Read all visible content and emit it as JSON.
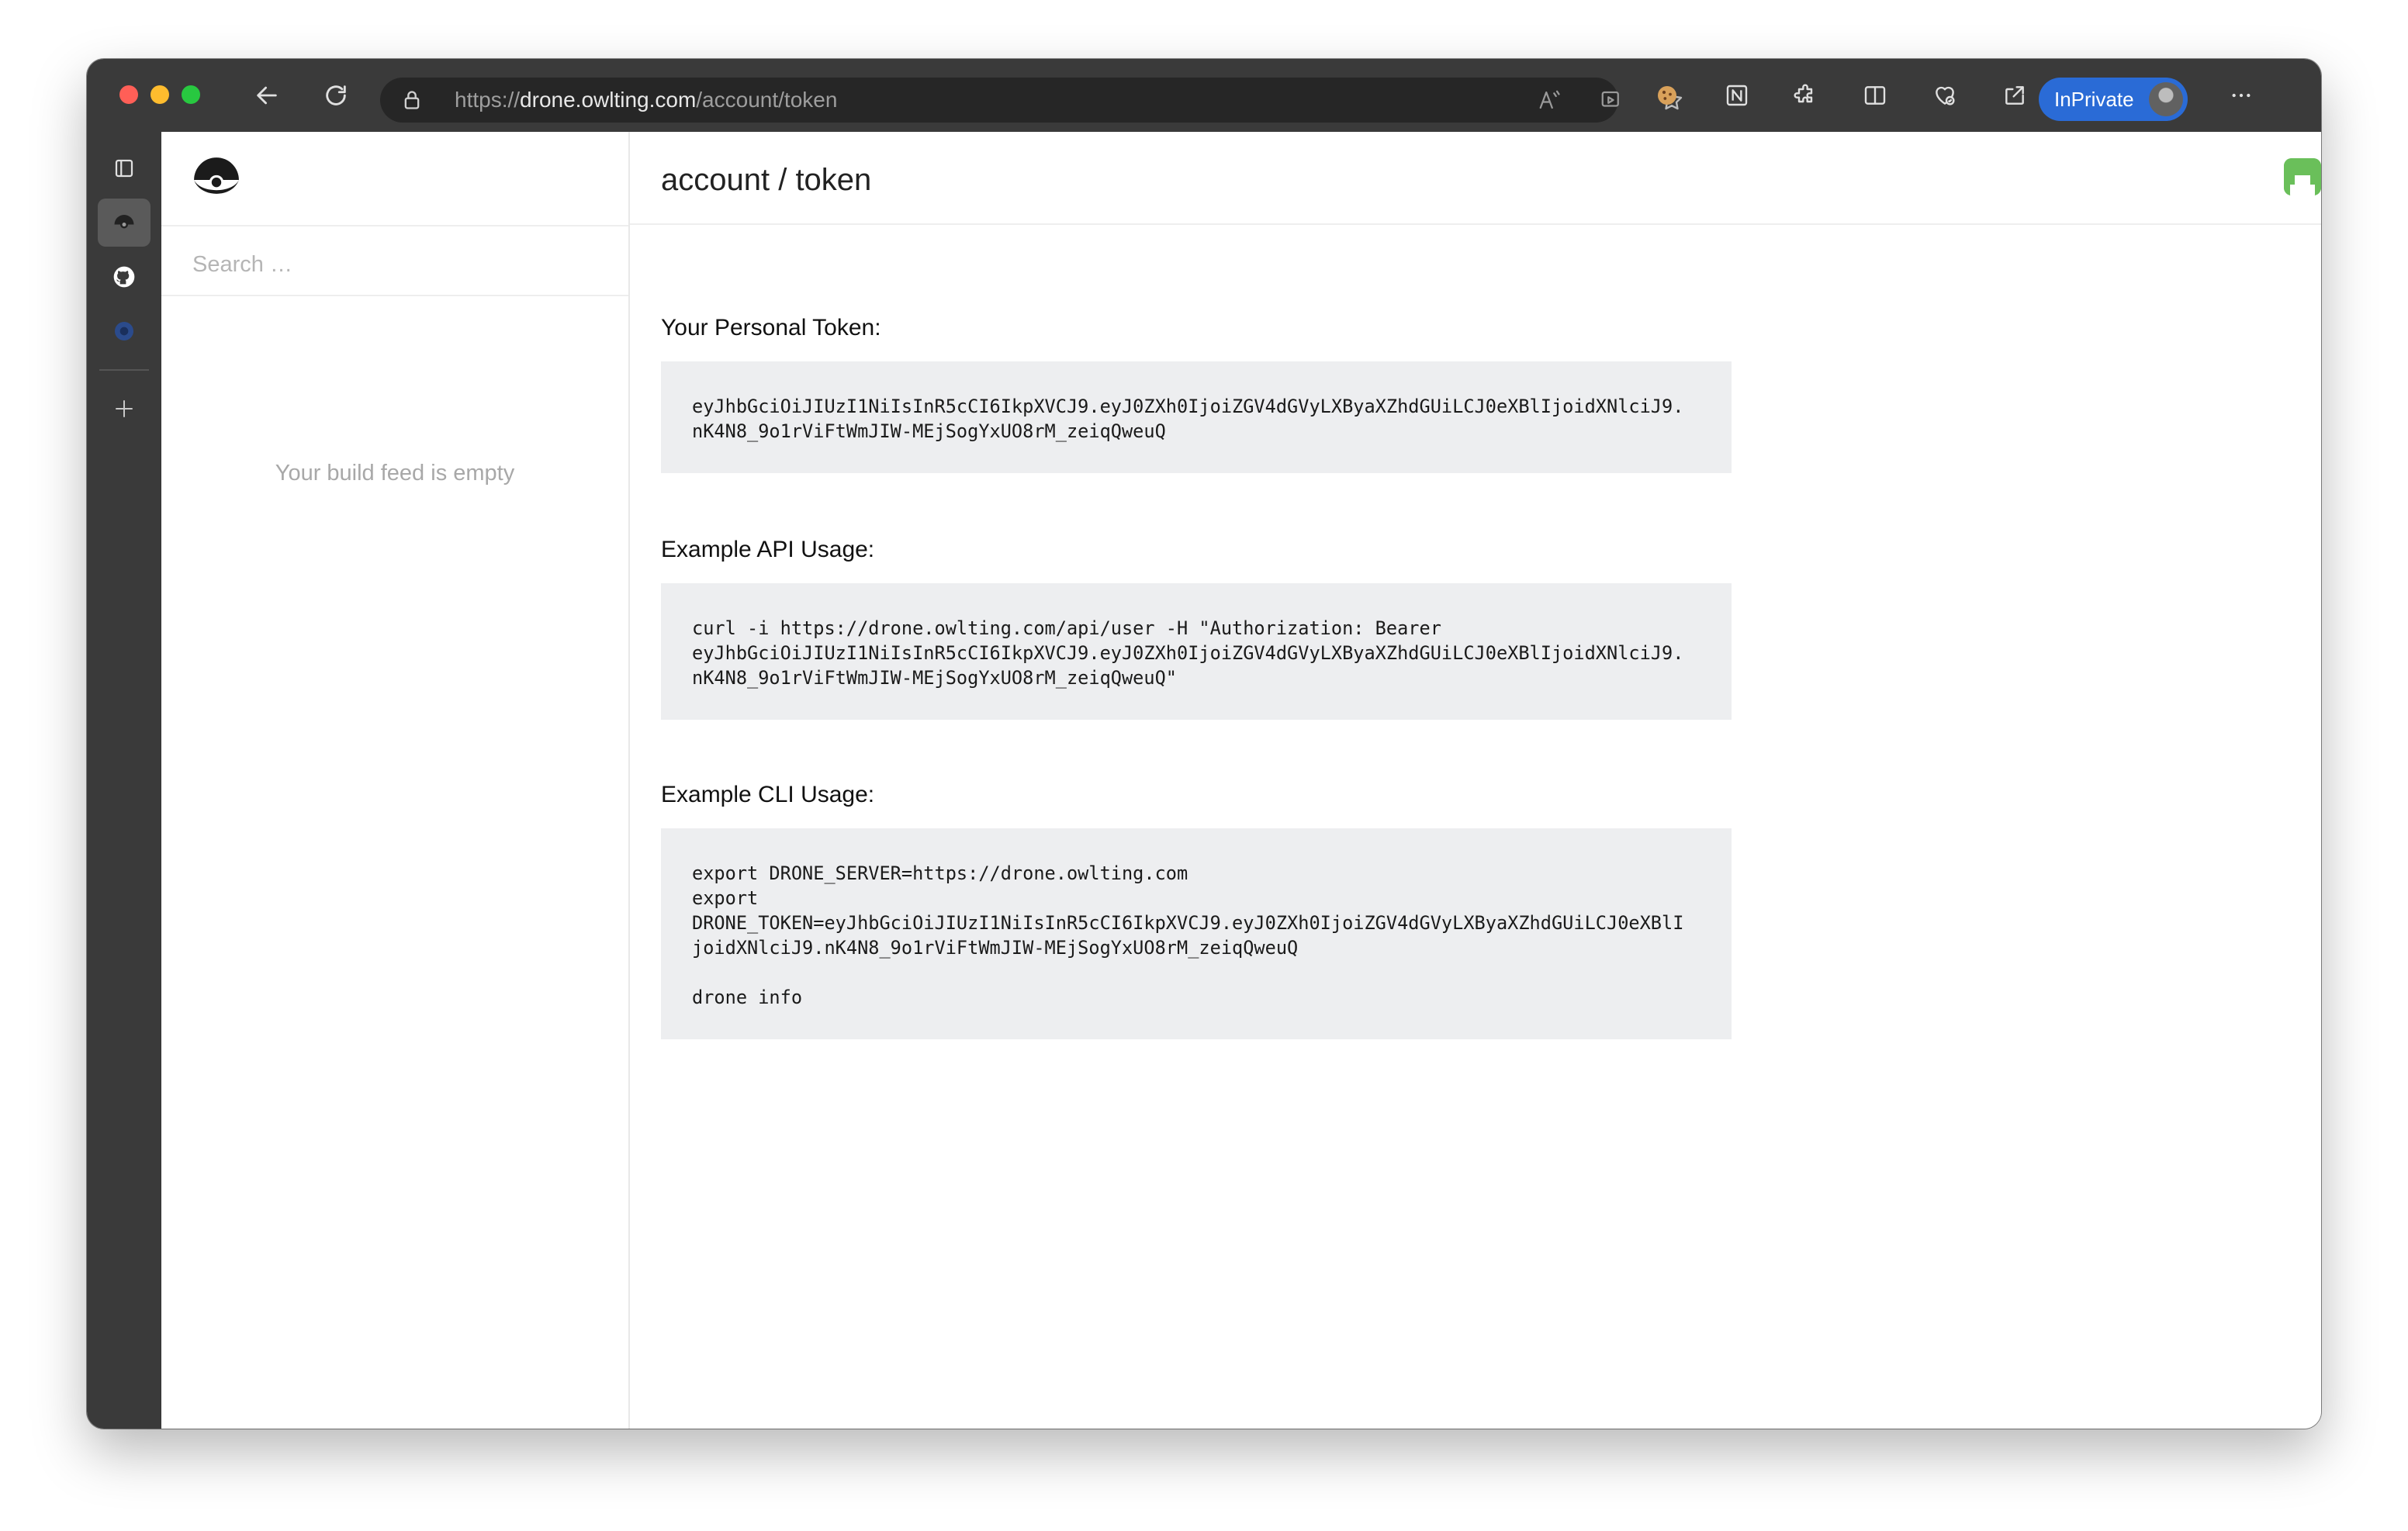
{
  "browser": {
    "url_scheme": "https://",
    "url_host": "drone.owlting.com",
    "url_path": "/account/token",
    "inprivate_label": "InPrivate"
  },
  "sidebar": {
    "search_placeholder": "Search …",
    "empty_message": "Your build feed is empty"
  },
  "header": {
    "breadcrumb": "account / token"
  },
  "token_section": {
    "title": "Your Personal Token:",
    "code": "eyJhbGciOiJIUzI1NiIsInR5cCI6IkpXVCJ9.eyJ0ZXh0IjoiZGV4dGVyLXByaXZhdGUiLCJ0eXBlIjoidXNlciJ9.\nnK4N8_9o1rViFtWmJIW-MEjSogYxUO8rM_zeiqQweuQ"
  },
  "api_section": {
    "title": "Example API Usage:",
    "code": "curl -i https://drone.owlting.com/api/user -H \"Authorization: Bearer\neyJhbGciOiJIUzI1NiIsInR5cCI6IkpXVCJ9.eyJ0ZXh0IjoiZGV4dGVyLXByaXZhdGUiLCJ0eXBlIjoidXNlciJ9.\nnK4N8_9o1rViFtWmJIW-MEjSogYxUO8rM_zeiqQweuQ\""
  },
  "cli_section": {
    "title": "Example CLI Usage:",
    "code": "export DRONE_SERVER=https://drone.owlting.com\nexport\nDRONE_TOKEN=eyJhbGciOiJIUzI1NiIsInR5cCI6IkpXVCJ9.eyJ0ZXh0IjoiZGV4dGVyLXByaXZhdGUiLCJ0eXBlI\njoidXNlciJ9.nK4N8_9o1rViFtWmJIW-MEjSogYxUO8rM_zeiqQweuQ\n\ndrone info"
  },
  "colors": {
    "browser_chrome": "#3a3a3a",
    "address_bar": "#262626",
    "inprivate_badge": "#2a6bd6",
    "code_background": "#edeef0",
    "avatar": "#6abf5a"
  }
}
